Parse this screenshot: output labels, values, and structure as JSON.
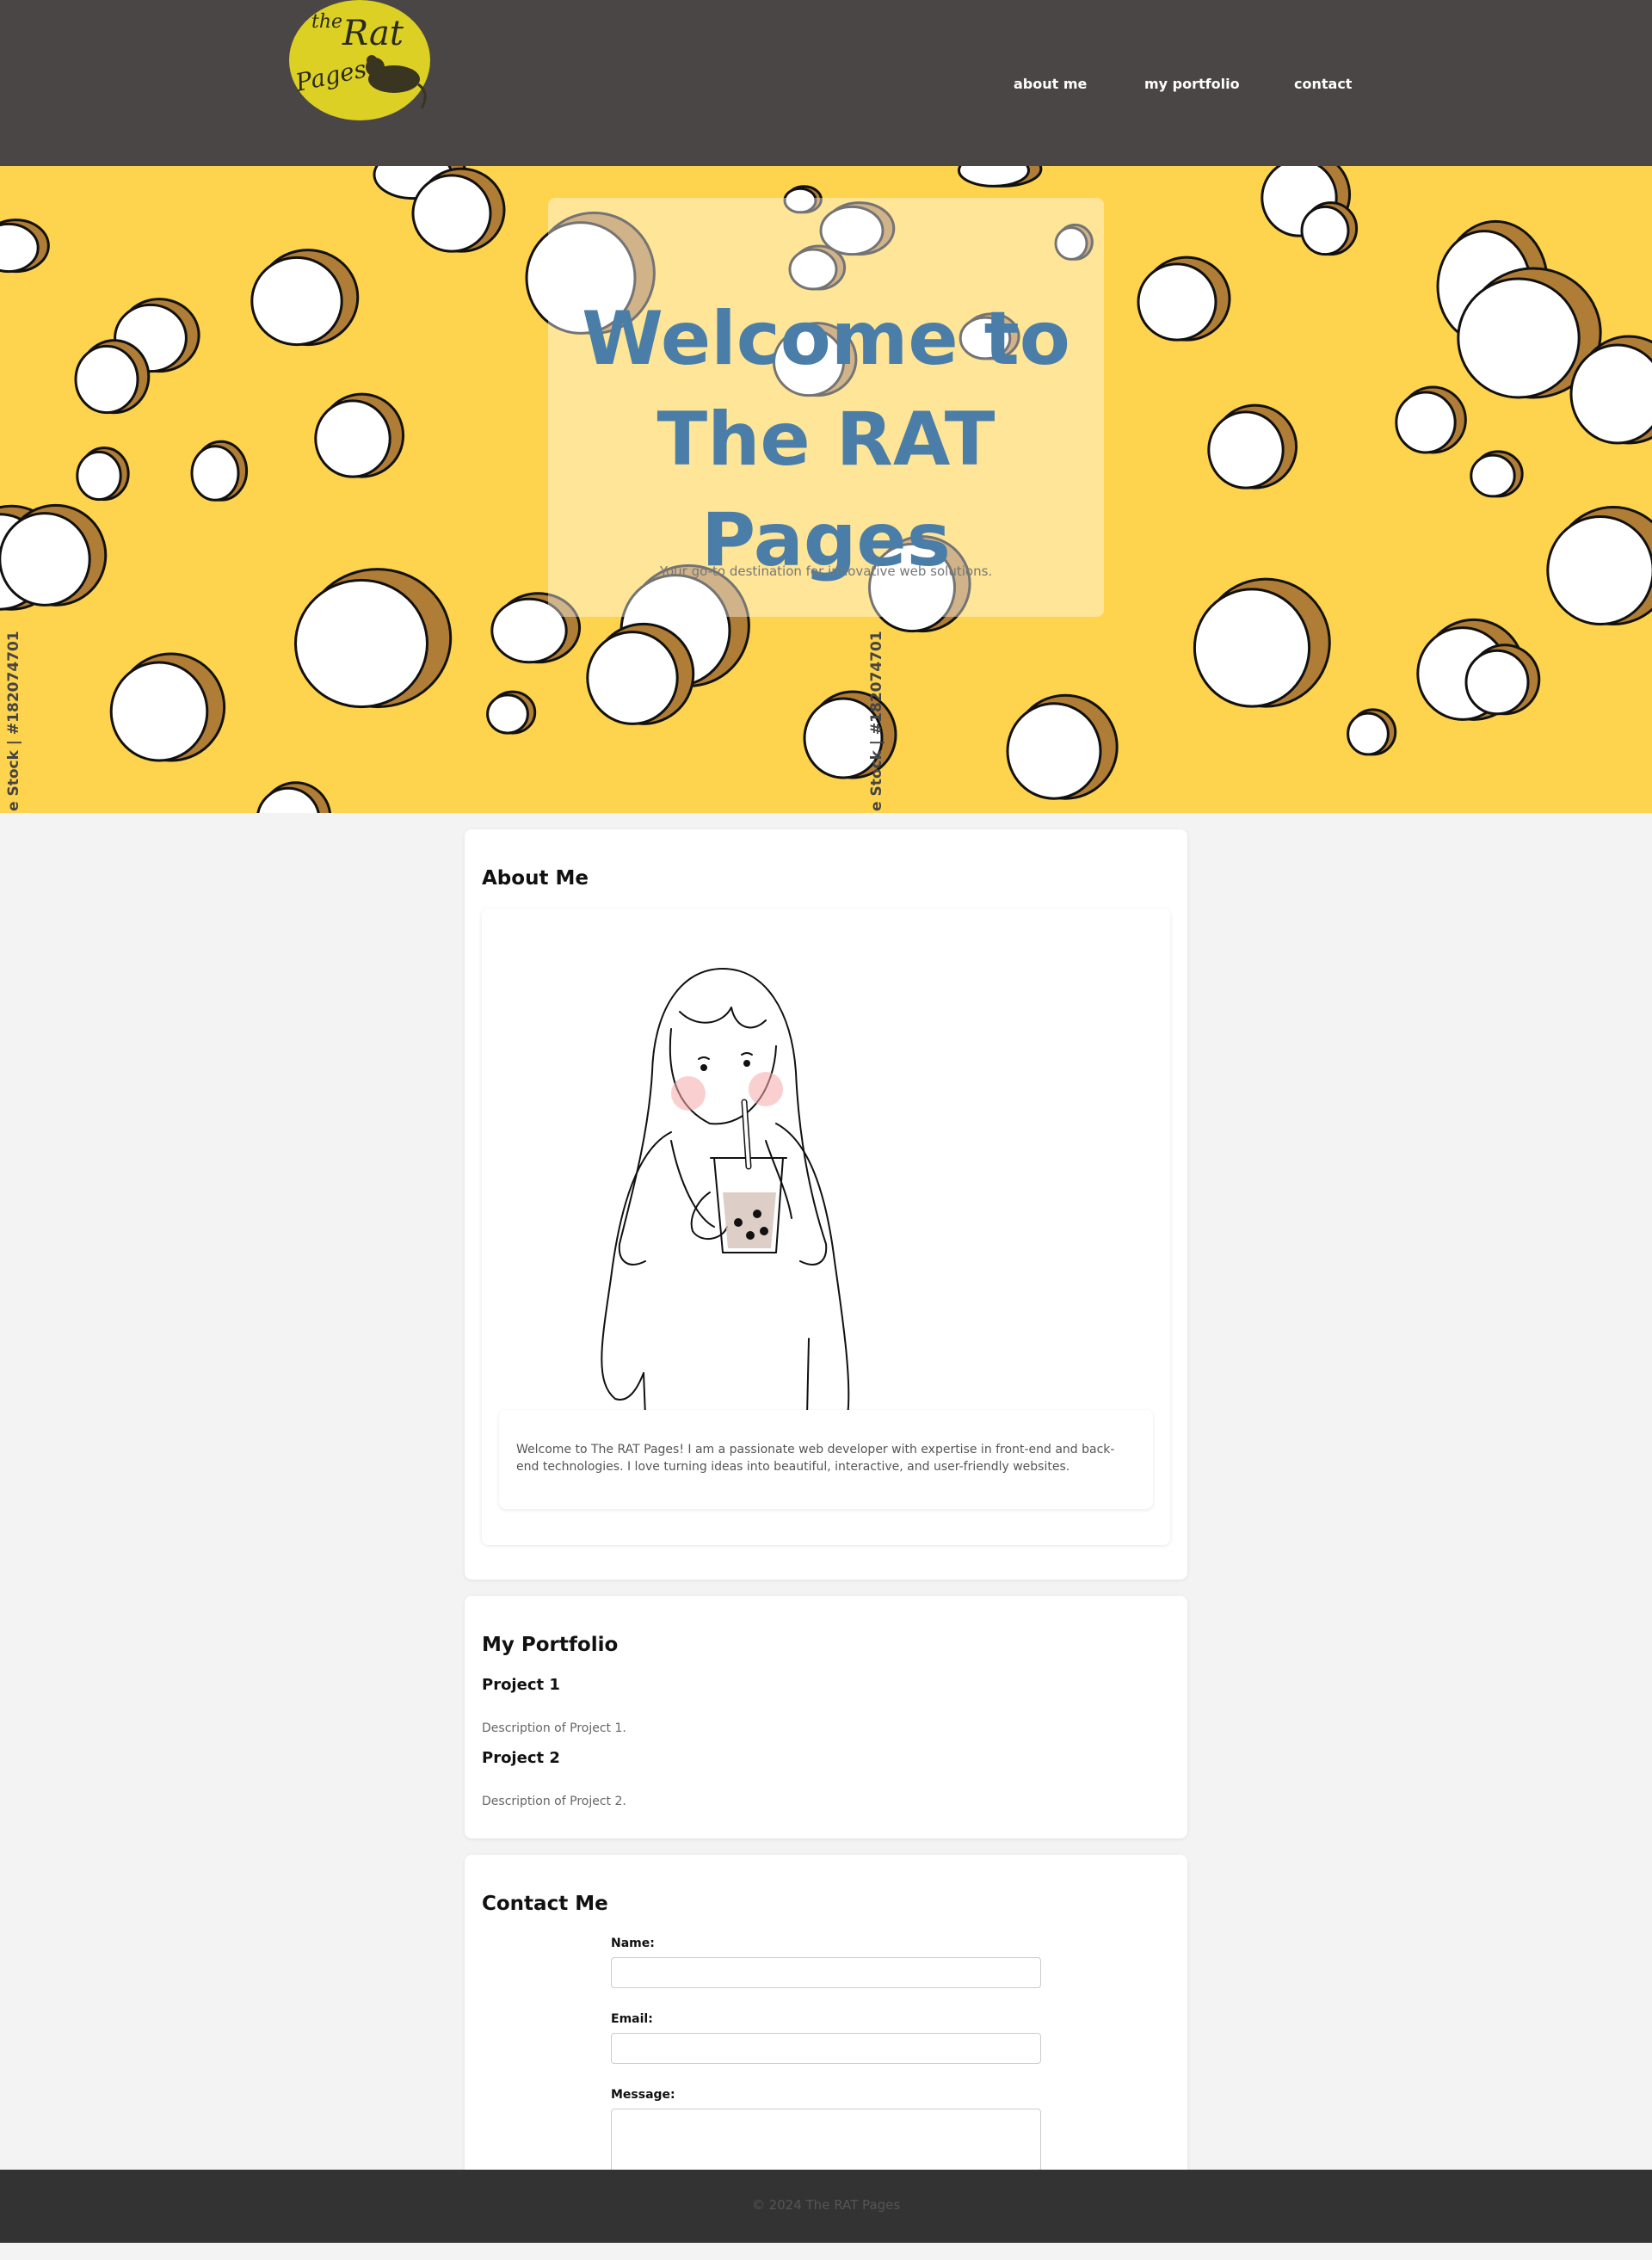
{
  "header": {
    "logo_text_line1": "the",
    "logo_text_line2": "Rat",
    "logo_text_line3": "Pages",
    "nav": [
      {
        "label": "about me"
      },
      {
        "label": "my portfolio"
      },
      {
        "label": "contact"
      }
    ]
  },
  "hero": {
    "title_line1": "Welcome to",
    "title_line2": "The RAT Pages",
    "subtitle": "Your go-to destination for innovative web solutions.",
    "watermark": "e Stock | #182074701"
  },
  "about": {
    "heading": "About Me",
    "image_icon": "girl-drinking-bubble-tea-illustration",
    "text": "Welcome to The RAT Pages! I am a passionate web developer with expertise in front-end and back-end technologies. I love turning ideas into beautiful, interactive, and user-friendly websites."
  },
  "portfolio": {
    "heading": "My Portfolio",
    "projects": [
      {
        "title": "Project 1",
        "description": "Description of Project 1."
      },
      {
        "title": "Project 2",
        "description": "Description of Project 2."
      }
    ]
  },
  "contact": {
    "heading": "Contact Me",
    "name_label": "Name:",
    "name_value": "",
    "email_label": "Email:",
    "email_value": "",
    "message_label": "Message:",
    "message_value": ""
  },
  "footer": {
    "copyright": "© 2024 The RAT Pages"
  },
  "colors": {
    "header_bg": "#4a4646",
    "hero_bg": "#fed34e",
    "hero_title": "#4a7ea8",
    "page_bg": "#f3f3f3",
    "footer_bg": "#333333"
  }
}
